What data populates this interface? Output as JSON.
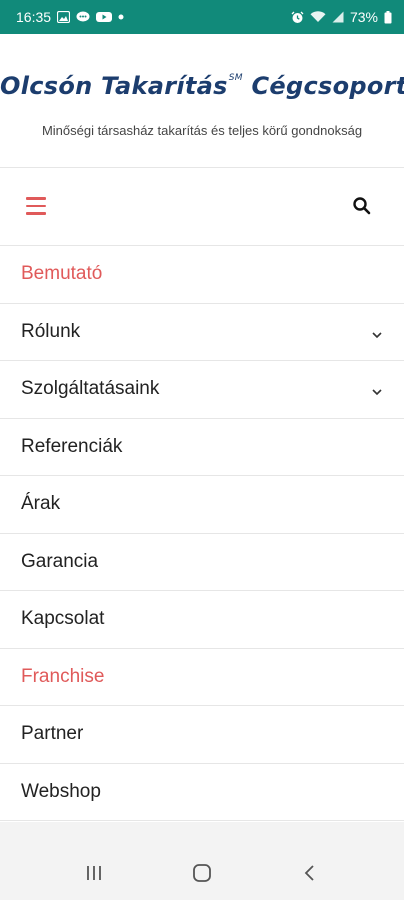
{
  "status_bar": {
    "time": "16:35",
    "battery": "73%",
    "left_icons": [
      "gallery-icon",
      "message-icon",
      "youtube-icon",
      "dot-icon"
    ],
    "right_icons": [
      "alarm-icon",
      "wifi-icon",
      "signal-icon",
      "battery-icon"
    ]
  },
  "header": {
    "title": "Olcsón Takarítás",
    "title_mark": "SM",
    "title_suffix": "Cégcsoport",
    "tagline": "Minőségi társasház takarítás és teljes körű gondnokság"
  },
  "menu": {
    "items": [
      {
        "label": "Bemutató",
        "accent": true,
        "has_submenu": false
      },
      {
        "label": "Rólunk",
        "accent": false,
        "has_submenu": true
      },
      {
        "label": "Szolgáltatásaink",
        "accent": false,
        "has_submenu": true
      },
      {
        "label": "Referenciák",
        "accent": false,
        "has_submenu": false
      },
      {
        "label": "Árak",
        "accent": false,
        "has_submenu": false
      },
      {
        "label": "Garancia",
        "accent": false,
        "has_submenu": false
      },
      {
        "label": "Kapcsolat",
        "accent": false,
        "has_submenu": false
      },
      {
        "label": "Franchise",
        "accent": true,
        "has_submenu": false
      },
      {
        "label": "Partner",
        "accent": false,
        "has_submenu": false
      },
      {
        "label": "Webshop",
        "accent": false,
        "has_submenu": false
      }
    ]
  },
  "colors": {
    "status_bar": "#118a7a",
    "title": "#1c3d6e",
    "accent": "#e05a5a",
    "text": "#222222"
  },
  "nav_icons": [
    "recent-apps-icon",
    "home-icon",
    "back-icon"
  ]
}
